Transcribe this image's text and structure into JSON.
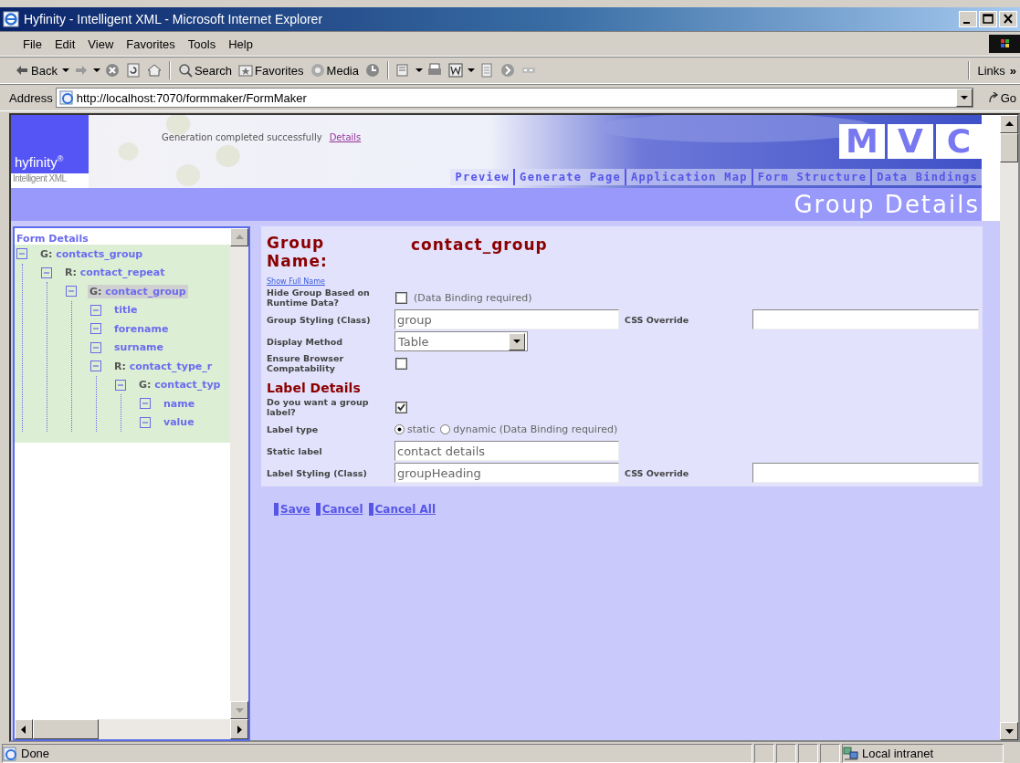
{
  "window": {
    "title": "Hyfinity - Intelligent XML - Microsoft Internet Explorer"
  },
  "menu": [
    "File",
    "Edit",
    "View",
    "Favorites",
    "Tools",
    "Help"
  ],
  "toolbar": {
    "back": "Back",
    "search": "Search",
    "favorites": "Favorites",
    "media": "Media",
    "links": "Links",
    "more": "»"
  },
  "address": {
    "label": "Address",
    "value": "http://localhost:7070/formmaker/FormMaker",
    "go": "Go"
  },
  "header": {
    "logo": "hyfinity$^{®}$",
    "tagline": "Intelligent XML",
    "message": "Generation completed successfully",
    "details_link": "Details",
    "mvc": [
      "M",
      "V",
      "C"
    ],
    "nav": [
      {
        "label": "Preview"
      },
      {
        "label": "Generate Page"
      },
      {
        "label": "Application Map"
      },
      {
        "label": "Form Structure"
      },
      {
        "label": "Data Bindings"
      }
    ],
    "page_title": "Group Details"
  },
  "tree": {
    "title": "Form Details",
    "nodes": [
      {
        "prefix": "G:",
        "label": "contacts_group",
        "expanded": true,
        "selected": false,
        "children": [
          {
            "prefix": "R:",
            "label": "contact_repeat",
            "expanded": true,
            "selected": false,
            "children": [
              {
                "prefix": "G:",
                "label": "contact_group",
                "expanded": true,
                "selected": true,
                "children": [
                  {
                    "label": "title",
                    "expanded": true,
                    "selected": false
                  },
                  {
                    "label": "forename",
                    "expanded": true,
                    "selected": false
                  },
                  {
                    "label": "surname",
                    "expanded": true,
                    "selected": false
                  },
                  {
                    "prefix": "R:",
                    "label": "contact_type_r",
                    "expanded": true,
                    "selected": false,
                    "children": [
                      {
                        "prefix": "G:",
                        "label": "contact_typ",
                        "expanded": true,
                        "selected": false,
                        "children": [
                          {
                            "label": "name",
                            "expanded": true,
                            "selected": false
                          },
                          {
                            "label": "value",
                            "expanded": true,
                            "selected": false
                          }
                        ]
                      }
                    ]
                  }
                ]
              }
            ]
          }
        ]
      }
    ]
  },
  "form": {
    "name_label": "Group Name:",
    "name_value": "contact_group",
    "show_full_name": "Show Full Name",
    "rows": [
      {
        "kind": "checkbox",
        "label": "Hide Group Based on Runtime Data?",
        "checked": false,
        "note": "(Data Binding required)"
      },
      {
        "kind": "text",
        "label": "Group Styling (Class)",
        "value": "group",
        "override_label": "CSS Override"
      },
      {
        "kind": "select",
        "label": "Display Method",
        "value": "Table"
      },
      {
        "kind": "checkbox",
        "label": "Ensure Browser Compatability",
        "checked": false
      },
      {
        "kind": "heading",
        "label": "Label Details"
      },
      {
        "kind": "checkbox",
        "label": "Do you want a group label?",
        "checked": true
      },
      {
        "kind": "radio",
        "label": "Label type",
        "options": [
          {
            "label": "static",
            "selected": true
          },
          {
            "label": "dynamic (Data Binding required)",
            "selected": false
          }
        ]
      },
      {
        "kind": "text",
        "label": "Static label",
        "value": "contact details"
      },
      {
        "kind": "text",
        "label": "Label Styling (Class)",
        "value": "groupHeading",
        "override_label": "CSS Override"
      }
    ],
    "buttons": [
      "Save",
      "Cancel",
      "Cancel All"
    ]
  },
  "status_bar": {
    "text": "Done",
    "zone": "Local intranet"
  }
}
